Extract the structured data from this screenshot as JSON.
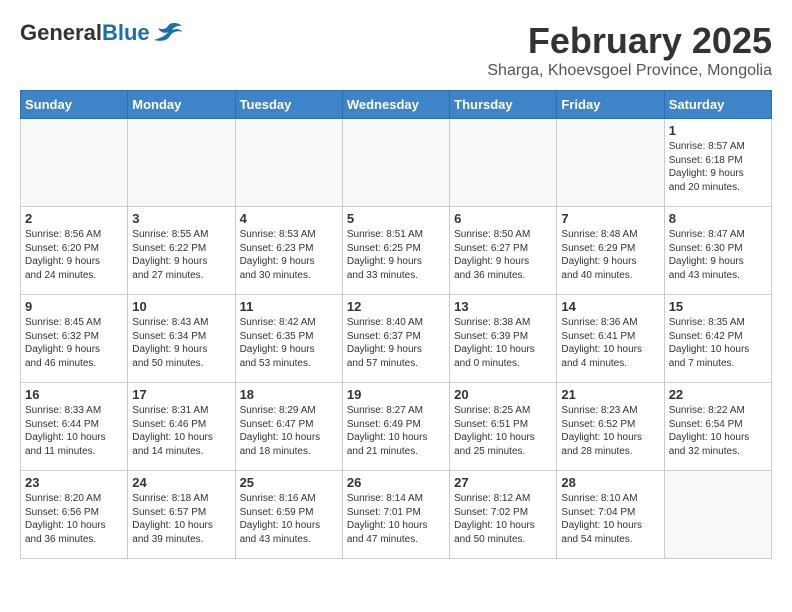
{
  "header": {
    "logo_line1": "General",
    "logo_line2": "Blue",
    "month_year": "February 2025",
    "location": "Sharga, Khoevsgoel Province, Mongolia"
  },
  "days_of_week": [
    "Sunday",
    "Monday",
    "Tuesday",
    "Wednesday",
    "Thursday",
    "Friday",
    "Saturday"
  ],
  "weeks": [
    [
      {
        "day": "",
        "info": ""
      },
      {
        "day": "",
        "info": ""
      },
      {
        "day": "",
        "info": ""
      },
      {
        "day": "",
        "info": ""
      },
      {
        "day": "",
        "info": ""
      },
      {
        "day": "",
        "info": ""
      },
      {
        "day": "1",
        "info": "Sunrise: 8:57 AM\nSunset: 6:18 PM\nDaylight: 9 hours\nand 20 minutes."
      }
    ],
    [
      {
        "day": "2",
        "info": "Sunrise: 8:56 AM\nSunset: 6:20 PM\nDaylight: 9 hours\nand 24 minutes."
      },
      {
        "day": "3",
        "info": "Sunrise: 8:55 AM\nSunset: 6:22 PM\nDaylight: 9 hours\nand 27 minutes."
      },
      {
        "day": "4",
        "info": "Sunrise: 8:53 AM\nSunset: 6:23 PM\nDaylight: 9 hours\nand 30 minutes."
      },
      {
        "day": "5",
        "info": "Sunrise: 8:51 AM\nSunset: 6:25 PM\nDaylight: 9 hours\nand 33 minutes."
      },
      {
        "day": "6",
        "info": "Sunrise: 8:50 AM\nSunset: 6:27 PM\nDaylight: 9 hours\nand 36 minutes."
      },
      {
        "day": "7",
        "info": "Sunrise: 8:48 AM\nSunset: 6:29 PM\nDaylight: 9 hours\nand 40 minutes."
      },
      {
        "day": "8",
        "info": "Sunrise: 8:47 AM\nSunset: 6:30 PM\nDaylight: 9 hours\nand 43 minutes."
      }
    ],
    [
      {
        "day": "9",
        "info": "Sunrise: 8:45 AM\nSunset: 6:32 PM\nDaylight: 9 hours\nand 46 minutes."
      },
      {
        "day": "10",
        "info": "Sunrise: 8:43 AM\nSunset: 6:34 PM\nDaylight: 9 hours\nand 50 minutes."
      },
      {
        "day": "11",
        "info": "Sunrise: 8:42 AM\nSunset: 6:35 PM\nDaylight: 9 hours\nand 53 minutes."
      },
      {
        "day": "12",
        "info": "Sunrise: 8:40 AM\nSunset: 6:37 PM\nDaylight: 9 hours\nand 57 minutes."
      },
      {
        "day": "13",
        "info": "Sunrise: 8:38 AM\nSunset: 6:39 PM\nDaylight: 10 hours\nand 0 minutes."
      },
      {
        "day": "14",
        "info": "Sunrise: 8:36 AM\nSunset: 6:41 PM\nDaylight: 10 hours\nand 4 minutes."
      },
      {
        "day": "15",
        "info": "Sunrise: 8:35 AM\nSunset: 6:42 PM\nDaylight: 10 hours\nand 7 minutes."
      }
    ],
    [
      {
        "day": "16",
        "info": "Sunrise: 8:33 AM\nSunset: 6:44 PM\nDaylight: 10 hours\nand 11 minutes."
      },
      {
        "day": "17",
        "info": "Sunrise: 8:31 AM\nSunset: 6:46 PM\nDaylight: 10 hours\nand 14 minutes."
      },
      {
        "day": "18",
        "info": "Sunrise: 8:29 AM\nSunset: 6:47 PM\nDaylight: 10 hours\nand 18 minutes."
      },
      {
        "day": "19",
        "info": "Sunrise: 8:27 AM\nSunset: 6:49 PM\nDaylight: 10 hours\nand 21 minutes."
      },
      {
        "day": "20",
        "info": "Sunrise: 8:25 AM\nSunset: 6:51 PM\nDaylight: 10 hours\nand 25 minutes."
      },
      {
        "day": "21",
        "info": "Sunrise: 8:23 AM\nSunset: 6:52 PM\nDaylight: 10 hours\nand 28 minutes."
      },
      {
        "day": "22",
        "info": "Sunrise: 8:22 AM\nSunset: 6:54 PM\nDaylight: 10 hours\nand 32 minutes."
      }
    ],
    [
      {
        "day": "23",
        "info": "Sunrise: 8:20 AM\nSunset: 6:56 PM\nDaylight: 10 hours\nand 36 minutes."
      },
      {
        "day": "24",
        "info": "Sunrise: 8:18 AM\nSunset: 6:57 PM\nDaylight: 10 hours\nand 39 minutes."
      },
      {
        "day": "25",
        "info": "Sunrise: 8:16 AM\nSunset: 6:59 PM\nDaylight: 10 hours\nand 43 minutes."
      },
      {
        "day": "26",
        "info": "Sunrise: 8:14 AM\nSunset: 7:01 PM\nDaylight: 10 hours\nand 47 minutes."
      },
      {
        "day": "27",
        "info": "Sunrise: 8:12 AM\nSunset: 7:02 PM\nDaylight: 10 hours\nand 50 minutes."
      },
      {
        "day": "28",
        "info": "Sunrise: 8:10 AM\nSunset: 7:04 PM\nDaylight: 10 hours\nand 54 minutes."
      },
      {
        "day": "",
        "info": ""
      }
    ]
  ]
}
